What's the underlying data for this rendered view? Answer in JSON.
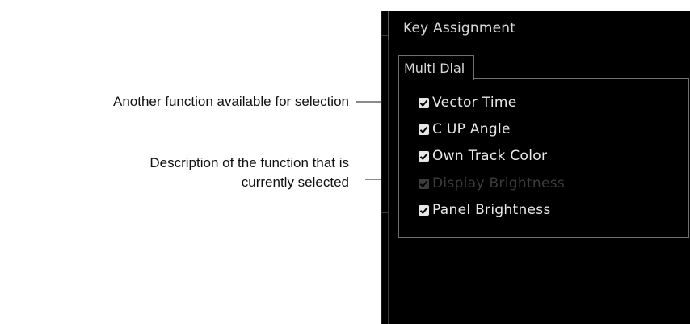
{
  "callouts": {
    "other_function": "Another function available for selection",
    "description_line1": "Description of the function that is",
    "description_line2": "currently selected"
  },
  "panel": {
    "title": "Key Assignment",
    "tab_label": "Multi Dial",
    "options": [
      {
        "label": "Vector Time",
        "checked": true,
        "enabled": true
      },
      {
        "label": "C UP Angle",
        "checked": true,
        "enabled": true
      },
      {
        "label": "Own Track Color",
        "checked": true,
        "enabled": true
      },
      {
        "label": "Display Brightness",
        "checked": true,
        "enabled": false
      },
      {
        "label": "Panel Brightness",
        "checked": true,
        "enabled": true
      }
    ]
  },
  "colors": {
    "panel_background": "#000000",
    "text": "#d9d9d9",
    "disabled_text": "#3c3c3c",
    "leader_line": "#8a8a8a"
  },
  "icons": {
    "checkbox": "checkmark-icon"
  }
}
